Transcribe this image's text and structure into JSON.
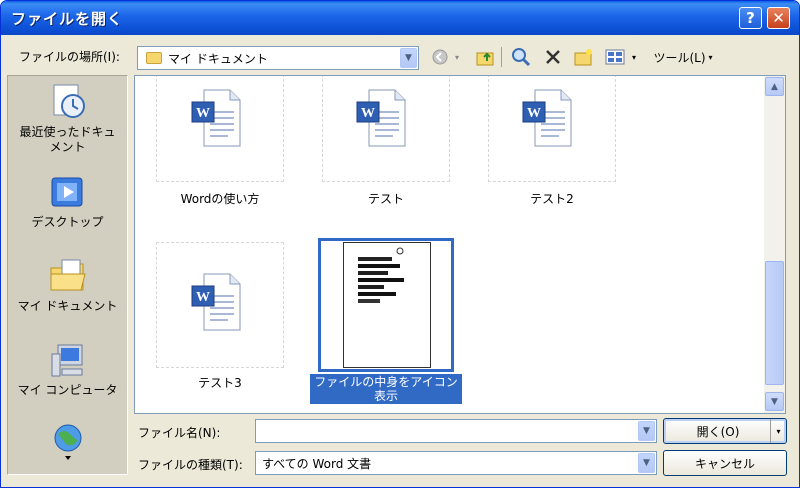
{
  "window": {
    "title": "ファイルを開く",
    "help_glyph": "?",
    "close_glyph": "✕"
  },
  "toolbar": {
    "look_in_label": "ファイルの場所(I):",
    "look_in_value": "マイ ドキュメント",
    "tools_label": "ツール(L)"
  },
  "places": [
    {
      "label": "最近使ったドキュメント",
      "icon": "recent-documents-icon"
    },
    {
      "label": "デスクトップ",
      "icon": "desktop-icon"
    },
    {
      "label": "マイ ドキュメント",
      "icon": "my-documents-icon"
    },
    {
      "label": "マイ コンピュータ",
      "icon": "my-computer-icon"
    },
    {
      "label": "",
      "icon": "network-places-icon"
    }
  ],
  "files": [
    {
      "name": "Wordの使い方",
      "type": "word-document",
      "selected": false
    },
    {
      "name": "テスト",
      "type": "word-document",
      "selected": false
    },
    {
      "name": "テスト2",
      "type": "word-document",
      "selected": false
    },
    {
      "name": "テスト3",
      "type": "word-document",
      "selected": false
    },
    {
      "name": "ファイルの中身をアイコン表示",
      "type": "word-document-preview",
      "selected": true
    }
  ],
  "bottom": {
    "filename_label": "ファイル名(N):",
    "filename_value": "",
    "filetype_label": "ファイルの種類(T):",
    "filetype_value": "すべての Word 文書",
    "open_label": "開く(O)",
    "cancel_label": "キャンセル"
  },
  "colors": {
    "titlebar": "#0a5fe6",
    "selection": "#316ac5",
    "dialog_bg": "#ece9d8"
  }
}
